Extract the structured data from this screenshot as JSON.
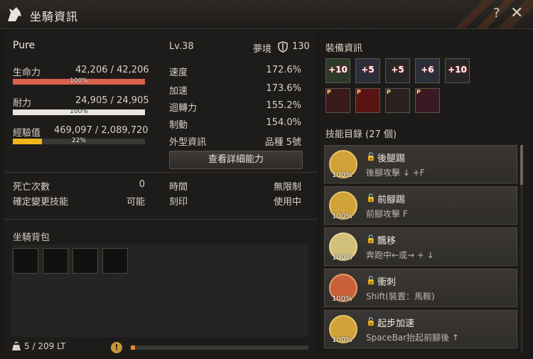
{
  "window": {
    "title": "坐騎資訊",
    "help": "?",
    "close": "✕"
  },
  "horse": {
    "name": "Pure",
    "level": "Lv.38",
    "realm_label": "夢境",
    "realm_value": "130",
    "hp": {
      "label": "生命力",
      "value": "42,206 / 42,206",
      "pct_label": "100%",
      "fraction": 1.0,
      "color": "#d9624e"
    },
    "stamina": {
      "label": "耐力",
      "value": "24,905 / 24,905",
      "pct_label": "100%",
      "fraction": 1.0,
      "color": "#e9e6df"
    },
    "exp": {
      "label": "經驗值",
      "value": "469,097 / 2,089,720",
      "pct_label": "22%",
      "fraction": 0.22,
      "color": "#f2b41c"
    }
  },
  "stats": [
    {
      "label": "速度",
      "value": "172.6%"
    },
    {
      "label": "加速",
      "value": "173.6%"
    },
    {
      "label": "迴轉力",
      "value": "155.2%"
    },
    {
      "label": "制動",
      "value": "154.0%"
    },
    {
      "label": "外型資訊",
      "value": "品種 5號"
    }
  ],
  "detail_button": "查看詳細能力",
  "info_left": [
    {
      "label": "死亡次數",
      "value": "0"
    },
    {
      "label": "確定變更技能",
      "value": "可能"
    }
  ],
  "info_right": [
    {
      "label": "時間",
      "value": "無限制"
    },
    {
      "label": "刻印",
      "value": "使用中"
    }
  ],
  "bag": {
    "title": "坐騎背包",
    "weight": "5 / 209 LT",
    "warn_icon": "!"
  },
  "equipment": {
    "title": "裝備資訊",
    "row1": [
      "+10",
      "+5",
      "+5",
      "+6",
      "+10"
    ],
    "row2_badge": "P"
  },
  "skills": {
    "title": "技能目錄 (27 個)",
    "items": [
      {
        "name": "後腿踢",
        "desc": "後腳攻擊 ↓ +F",
        "pct": "100%"
      },
      {
        "name": "前腳踢",
        "desc": "前腳攻擊 F",
        "pct": "100%"
      },
      {
        "name": "飄移",
        "desc": "奔跑中←或→ + ↓",
        "pct": "100%"
      },
      {
        "name": "衝刺",
        "desc": "Shift(裝置：馬鞍)",
        "pct": "100%"
      },
      {
        "name": "起步加速",
        "desc": "SpaceBar抬起前腳後 ↑",
        "pct": "100%"
      }
    ]
  }
}
